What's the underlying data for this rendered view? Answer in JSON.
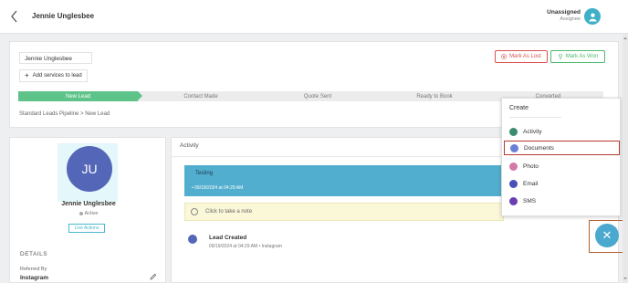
{
  "header": {
    "title": "Jennie Unglesbee",
    "assignee_label": "Unassigned",
    "assignee_sub": "Assignee",
    "back_icon": "chevron-left-icon",
    "avatar_icon": "user-icon"
  },
  "lead": {
    "name": "Jennie Unglesbee",
    "add_services": "Add services to lead",
    "mark_lost": "Mark As Lost",
    "mark_won": "Mark As Won",
    "stages": [
      "New Lead",
      "Contact Made",
      "Quote Sent",
      "Ready to Book",
      "Converted"
    ],
    "active_stage": "New Lead",
    "breadcrumb": "Standard Leads Pipeline  >  New Lead"
  },
  "profile": {
    "initials": "JU",
    "name": "Jennie Unglesbee",
    "status": "Active",
    "live_action": "Live Actions",
    "details_heading": "DETAILS",
    "referred_by_label": "Referred By",
    "referred_by_value": "Instagram"
  },
  "activity": {
    "title": "Activity",
    "testing_title": "Testing",
    "testing_meta": "•  09/19/2024 at 04:29 AM",
    "note_placeholder": "Click to take a note",
    "lead_created_title": "Lead Created",
    "lead_created_meta": "09/19/2024 at 04:29 AM   •   Instagram"
  },
  "create_menu": {
    "heading": "Create",
    "items": [
      {
        "label": "Activity",
        "icon": "activity-icon",
        "color": "#3a8c6e"
      },
      {
        "label": "Documents",
        "icon": "documents-icon",
        "color": "#6a7fd6"
      },
      {
        "label": "Photo",
        "icon": "photo-icon",
        "color": "#d47aa6"
      },
      {
        "label": "Email",
        "icon": "email-icon",
        "color": "#4a4fb8"
      },
      {
        "label": "SMS",
        "icon": "sms-icon",
        "color": "#6a3db2"
      }
    ],
    "selected": "Documents"
  },
  "fab": {
    "icon": "close-icon",
    "glyph": "✕"
  },
  "colors": {
    "accent": "#4ba8cf",
    "won": "#4cbb6c",
    "lost": "#d9534f",
    "stage_active": "#5dc389"
  }
}
